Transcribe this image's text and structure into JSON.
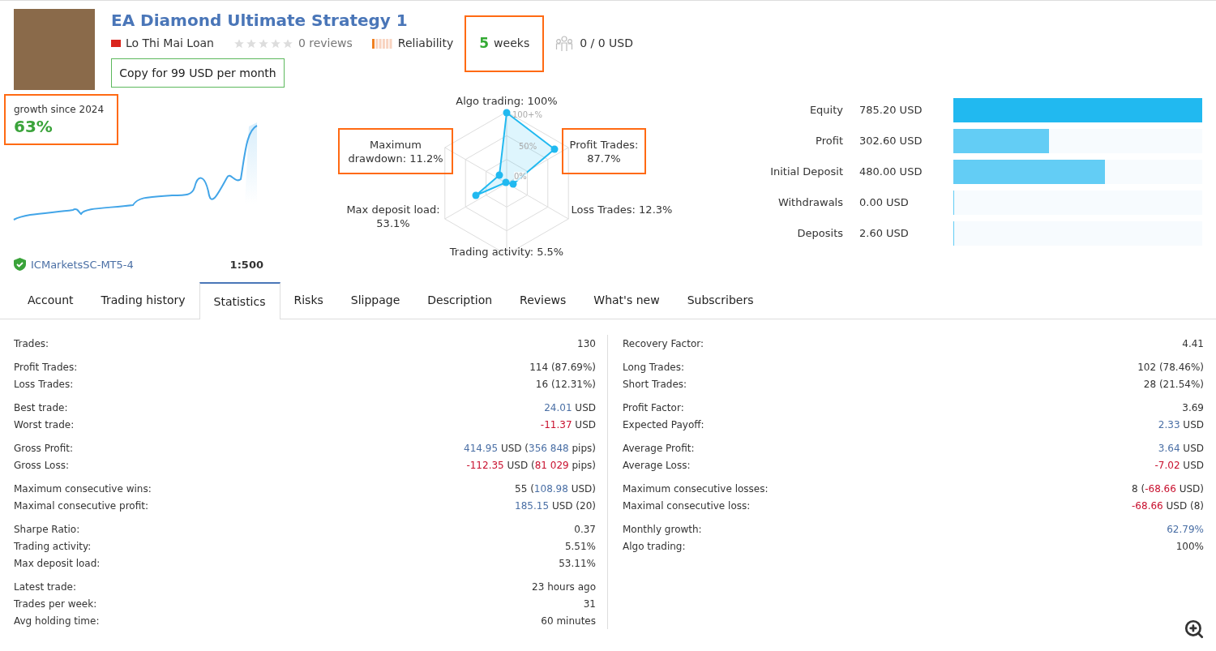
{
  "header": {
    "title": "EA Diamond Ultimate Strategy 1",
    "author": "Lo Thi Mai Loan",
    "stars": 0,
    "reviews": "0 reviews",
    "reliability": "Reliability",
    "weeks": {
      "number": "5",
      "unit": "weeks",
      "highlighted": true
    },
    "subscribers": "0 / 0 USD",
    "copy_button": "Copy for 99 USD per month"
  },
  "growth": {
    "caption": "growth since 2024",
    "value": "63%",
    "highlighted": true,
    "broker": "ICMarketsSC-MT5-4",
    "leverage": "1:500"
  },
  "radar": {
    "ticks": [
      "100+%",
      "50%",
      "0%"
    ],
    "labels": [
      {
        "kind": "top",
        "text": "Algo trading: 100%",
        "highlighted": false
      },
      {
        "kind": "upper-left",
        "text": "Maximum\ndrawdown: 11.2%",
        "highlighted": true
      },
      {
        "kind": "upper-right",
        "text": "Profit Trades:\n87.7%",
        "highlighted": true
      },
      {
        "kind": "lower-left",
        "text": "Max deposit load:\n53.1%",
        "highlighted": false
      },
      {
        "kind": "lower-right",
        "text": "Loss Trades: 12.3%",
        "highlighted": false
      },
      {
        "kind": "bottom",
        "text": "Trading activity: 5.5%",
        "highlighted": false
      }
    ]
  },
  "balance": [
    {
      "label": "Equity",
      "value": "785.20 USD",
      "level": 1,
      "color": "#21b9f0"
    },
    {
      "label": "Profit",
      "value": "302.60 USD",
      "level": 0.385,
      "color": "#63cdf5"
    },
    {
      "label": "Initial Deposit",
      "value": "480.00 USD",
      "level": 0.61,
      "color": "#63cdf5"
    },
    {
      "label": "Withdrawals",
      "value": "0.00 USD",
      "level": 0.004,
      "color": "#63cdf5"
    },
    {
      "label": "Deposits",
      "value": "2.60 USD",
      "level": 0.004,
      "color": "#63cdf5"
    }
  ],
  "tabs": [
    {
      "label": "Account",
      "selected": false
    },
    {
      "label": "Trading history",
      "selected": false
    },
    {
      "label": "Statistics",
      "selected": true
    },
    {
      "label": "Risks",
      "selected": false
    },
    {
      "label": "Slippage",
      "selected": false
    },
    {
      "label": "Description",
      "selected": false
    },
    {
      "label": "Reviews",
      "selected": false
    },
    {
      "label": "What's new",
      "selected": false
    },
    {
      "label": "Subscribers",
      "selected": false
    }
  ],
  "stats_left": [
    [
      {
        "label": "Trades:",
        "value": [
          {
            "text": "130",
            "color": "#333333"
          }
        ]
      }
    ],
    [
      {
        "label": "Profit Trades:",
        "value": [
          {
            "text": "114 (87.69%)",
            "color": "#333333"
          }
        ]
      },
      {
        "label": "Loss Trades:",
        "value": [
          {
            "text": "16 (12.31%)",
            "color": "#333333"
          }
        ]
      }
    ],
    [
      {
        "label": "Best trade:",
        "value": [
          {
            "text": "24.01",
            "color": "#4a6fa5"
          },
          {
            "text": " USD",
            "color": "#333333"
          }
        ]
      },
      {
        "label": "Worst trade:",
        "value": [
          {
            "text": "-11.37",
            "color": "#c8102e"
          },
          {
            "text": " USD",
            "color": "#333333"
          }
        ]
      }
    ],
    [
      {
        "label": "Gross Profit:",
        "value": [
          {
            "text": "414.95",
            "color": "#4a6fa5"
          },
          {
            "text": " USD (",
            "color": "#333333"
          },
          {
            "text": "356 848",
            "color": "#4a6fa5"
          },
          {
            "text": " pips)",
            "color": "#333333"
          }
        ]
      },
      {
        "label": "Gross Loss:",
        "value": [
          {
            "text": "-112.35",
            "color": "#c8102e"
          },
          {
            "text": " USD (",
            "color": "#333333"
          },
          {
            "text": "81 029",
            "color": "#c8102e"
          },
          {
            "text": " pips)",
            "color": "#333333"
          }
        ]
      }
    ],
    [
      {
        "label": "Maximum consecutive wins:",
        "value": [
          {
            "text": "55 (",
            "color": "#333333"
          },
          {
            "text": "108.98",
            "color": "#4a6fa5"
          },
          {
            "text": " USD)",
            "color": "#333333"
          }
        ]
      },
      {
        "label": "Maximal consecutive profit:",
        "value": [
          {
            "text": "185.15",
            "color": "#4a6fa5"
          },
          {
            "text": " USD (20)",
            "color": "#333333"
          }
        ]
      }
    ],
    [
      {
        "label": "Sharpe Ratio:",
        "value": [
          {
            "text": "0.37",
            "color": "#333333"
          }
        ]
      },
      {
        "label": "Trading activity:",
        "value": [
          {
            "text": "5.51%",
            "color": "#333333"
          }
        ]
      },
      {
        "label": "Max deposit load:",
        "value": [
          {
            "text": "53.11%",
            "color": "#333333"
          }
        ]
      }
    ],
    [
      {
        "label": "Latest trade:",
        "value": [
          {
            "text": "23 hours ago",
            "color": "#333333"
          }
        ]
      },
      {
        "label": "Trades per week:",
        "value": [
          {
            "text": "31",
            "color": "#333333"
          }
        ]
      },
      {
        "label": "Avg holding time:",
        "value": [
          {
            "text": "60 minutes",
            "color": "#333333"
          }
        ]
      }
    ]
  ],
  "stats_right": [
    [
      {
        "label": "Recovery Factor:",
        "value": [
          {
            "text": "4.41",
            "color": "#333333"
          }
        ]
      }
    ],
    [
      {
        "label": "Long Trades:",
        "value": [
          {
            "text": "102 (78.46%)",
            "color": "#333333"
          }
        ]
      },
      {
        "label": "Short Trades:",
        "value": [
          {
            "text": "28 (21.54%)",
            "color": "#333333"
          }
        ]
      }
    ],
    [
      {
        "label": "Profit Factor:",
        "value": [
          {
            "text": "3.69",
            "color": "#333333"
          }
        ]
      },
      {
        "label": "Expected Payoff:",
        "value": [
          {
            "text": "2.33",
            "color": "#4a6fa5"
          },
          {
            "text": " USD",
            "color": "#333333"
          }
        ]
      }
    ],
    [
      {
        "label": "Average Profit:",
        "value": [
          {
            "text": "3.64",
            "color": "#4a6fa5"
          },
          {
            "text": " USD",
            "color": "#333333"
          }
        ]
      },
      {
        "label": "Average Loss:",
        "value": [
          {
            "text": "-7.02",
            "color": "#c8102e"
          },
          {
            "text": " USD",
            "color": "#333333"
          }
        ]
      }
    ],
    [
      {
        "label": "Maximum consecutive losses:",
        "value": [
          {
            "text": "8 (",
            "color": "#333333"
          },
          {
            "text": "-68.66",
            "color": "#c8102e"
          },
          {
            "text": " USD)",
            "color": "#333333"
          }
        ]
      },
      {
        "label": "Maximal consecutive loss:",
        "value": [
          {
            "text": "-68.66",
            "color": "#c8102e"
          },
          {
            "text": " USD (8)",
            "color": "#333333"
          }
        ]
      }
    ],
    [
      {
        "label": "Monthly growth:",
        "value": [
          {
            "text": "62.79%",
            "color": "#4a6fa5"
          }
        ]
      },
      {
        "label": "Algo trading:",
        "value": [
          {
            "text": "100%",
            "color": "#333333"
          }
        ]
      }
    ]
  ]
}
